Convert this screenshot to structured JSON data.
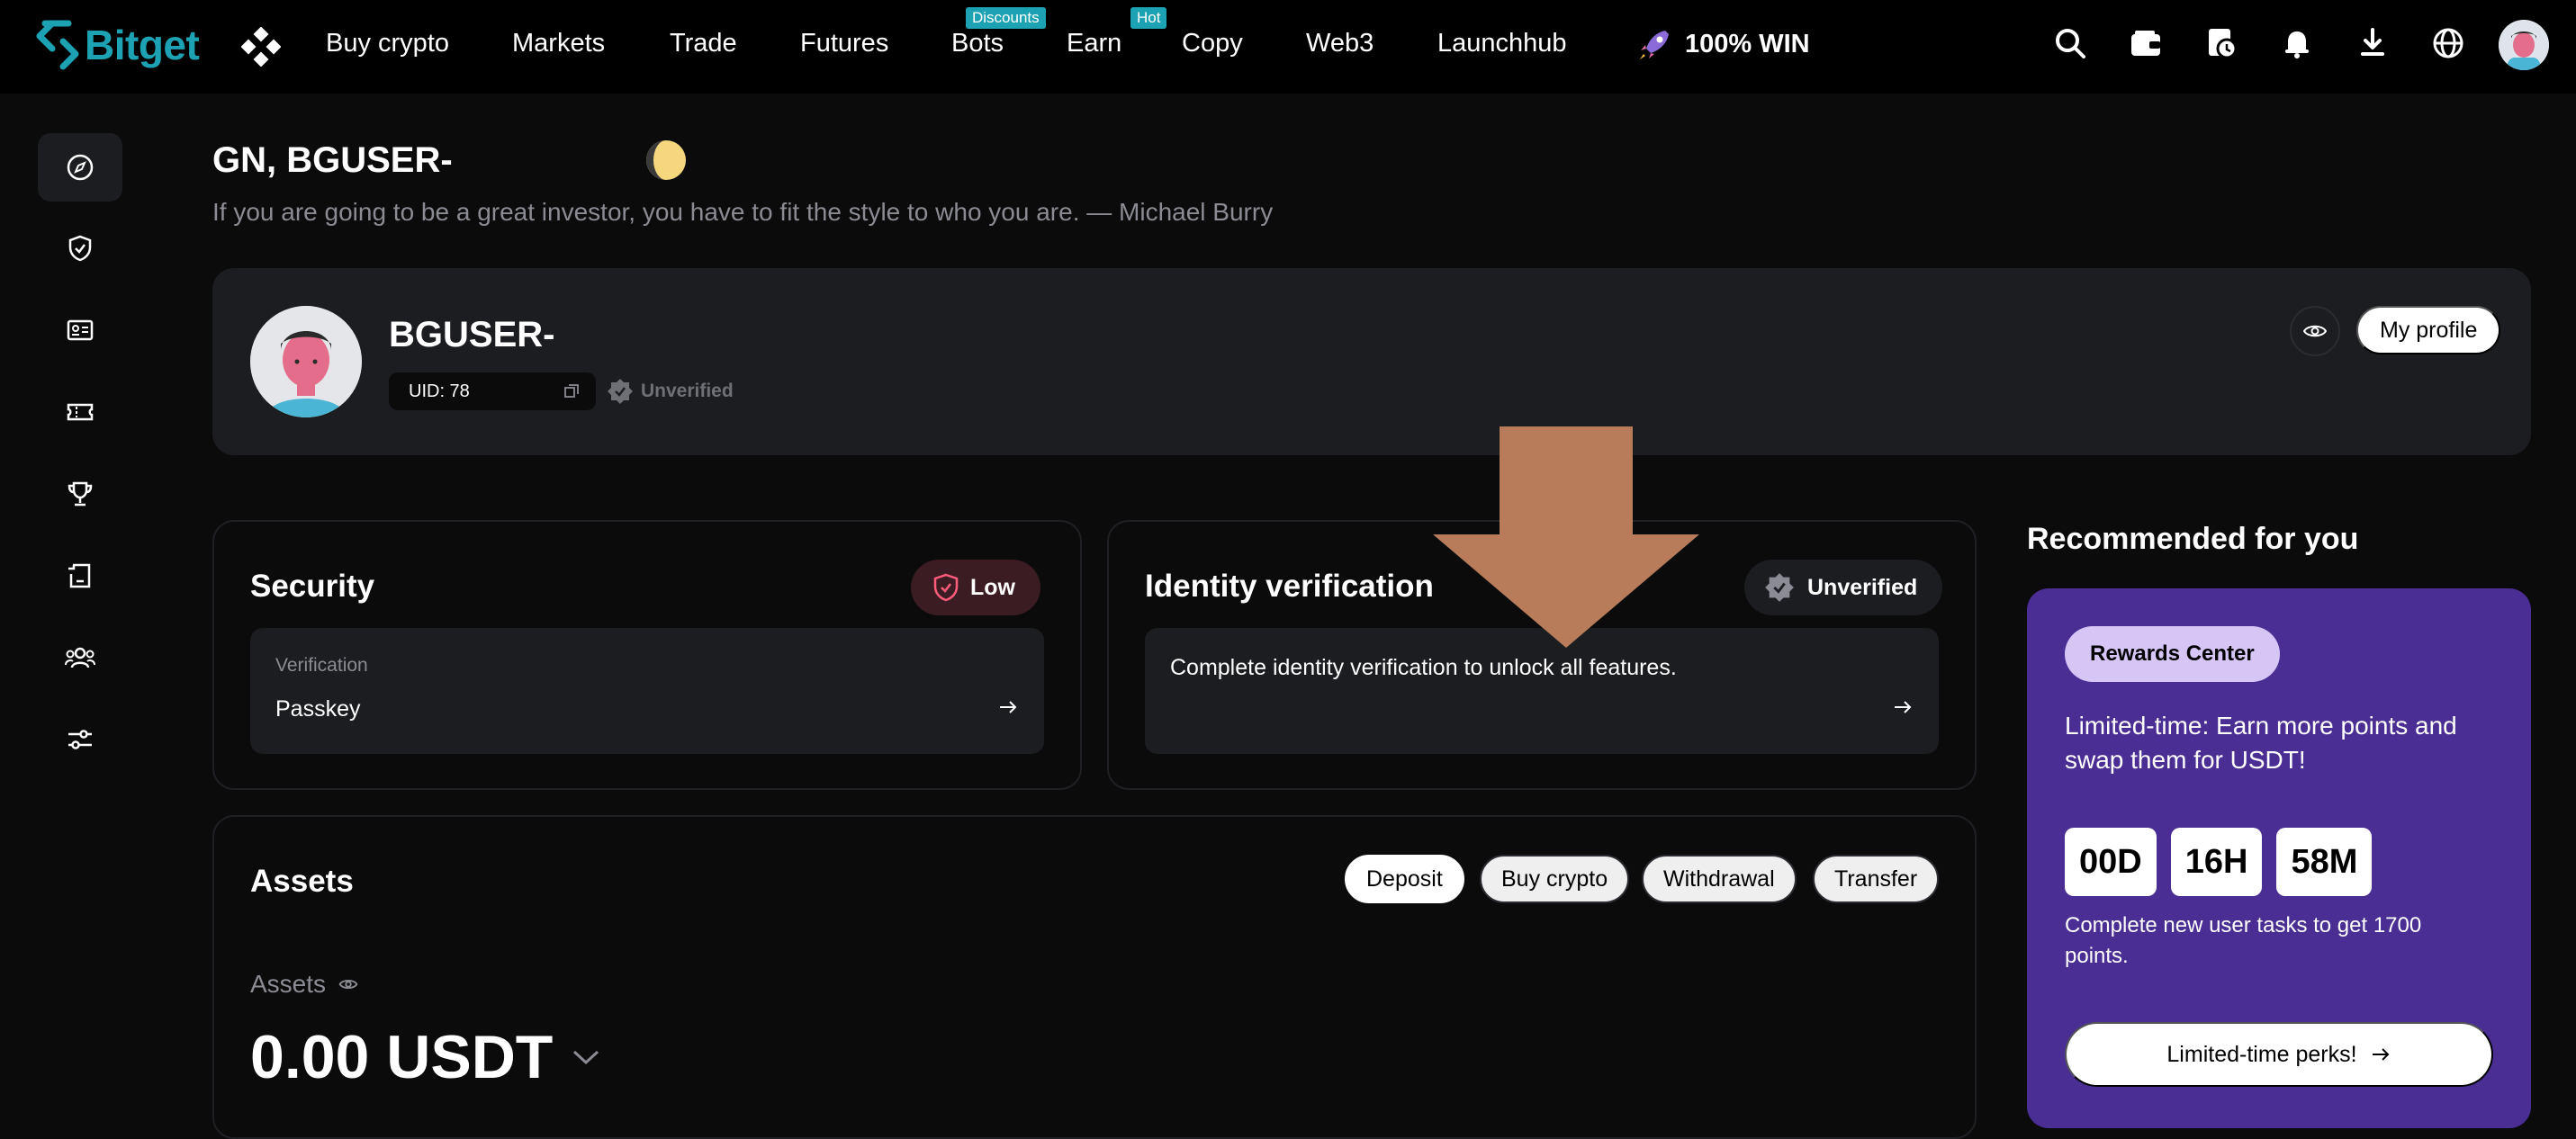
{
  "brand": {
    "name": "Bitget"
  },
  "nav": {
    "items": [
      {
        "label": "Buy crypto"
      },
      {
        "label": "Markets"
      },
      {
        "label": "Trade"
      },
      {
        "label": "Futures"
      },
      {
        "label": "Bots",
        "badge": "Discounts"
      },
      {
        "label": "Earn",
        "badge": "Hot"
      },
      {
        "label": "Copy"
      },
      {
        "label": "Web3"
      },
      {
        "label": "Launchhub"
      }
    ],
    "promo": "100% WIN",
    "icons": [
      "search-icon",
      "wallet-icon",
      "orders-icon",
      "bell-icon",
      "download-icon",
      "globe-icon",
      "avatar"
    ]
  },
  "sidebar": {
    "icons": [
      "compass-icon",
      "shield-check-icon",
      "id-card-icon",
      "ticket-icon",
      "trophy-icon",
      "referral-icon",
      "group-icon",
      "sliders-icon"
    ]
  },
  "header": {
    "greeting": "GN, BGUSER-",
    "quote": "If you are going to be a great investor, you have to fit the style to who you are. — Michael Burry"
  },
  "profile": {
    "name": "BGUSER-",
    "uid": "UID: 78",
    "status": "Unverified",
    "my_profile_label": "My profile"
  },
  "security": {
    "title": "Security",
    "level": "Low",
    "item_label": "Verification",
    "item_value": "Passkey"
  },
  "identity": {
    "title": "Identity verification",
    "status": "Unverified",
    "message": "Complete identity verification to unlock all features."
  },
  "assets": {
    "title": "Assets",
    "buttons": [
      "Deposit",
      "Buy crypto",
      "Withdrawal",
      "Transfer"
    ],
    "subtitle": "Assets",
    "value": "0.00 USDT"
  },
  "recommended": {
    "title": "Recommended for you",
    "pill": "Rewards Center",
    "text": "Limited-time: Earn more points and swap them for USDT!",
    "timer": {
      "days": "00D",
      "hours": "16H",
      "minutes": "58M"
    },
    "subtext": "Complete new user tasks to get 1700 points.",
    "button": "Limited-time perks!"
  },
  "colors": {
    "accent": "#1da2b4",
    "background": "#0b0b0c",
    "panel": "#1c1d21",
    "low_badge": "#3a1c22",
    "promo_card": "#4a2e93",
    "annotation_arrow": "#b87c5a"
  }
}
